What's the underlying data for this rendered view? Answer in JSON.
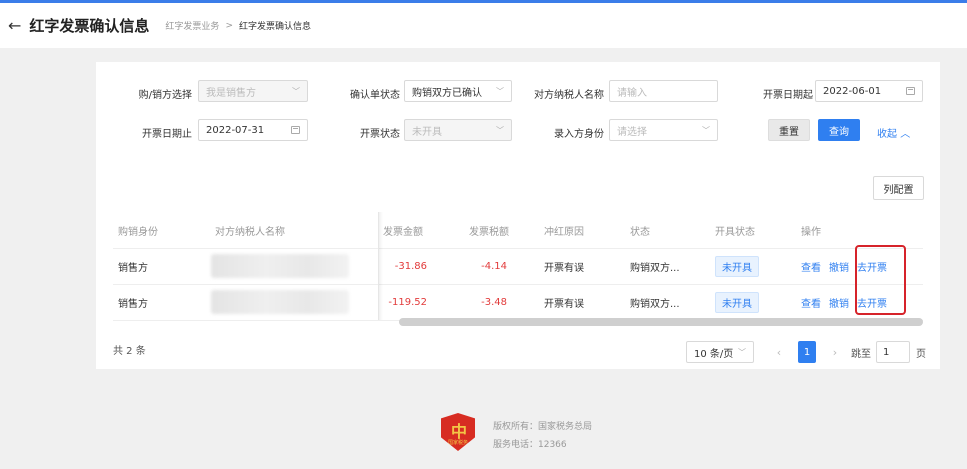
{
  "header": {
    "title": "红字发票确认信息",
    "breadcrumb": [
      "红字发票业务",
      "红字发票确认信息"
    ],
    "breadcrumb_sep": ">"
  },
  "filters": {
    "role_label": "购/销方选择",
    "role_value": "我是销售方",
    "confirm_status_label": "确认单状态",
    "confirm_status_value": "购销双方已确认",
    "counterparty_label": "对方纳税人名称",
    "counterparty_placeholder": "请输入",
    "date_start_label": "开票日期起",
    "date_start_value": "2022-06-01",
    "date_end_label": "开票日期止",
    "date_end_value": "2022-07-31",
    "issue_status_label": "开票状态",
    "issue_status_value": "未开具",
    "entry_identity_label": "录入方身份",
    "entry_identity_placeholder": "请选择"
  },
  "actions": {
    "reset": "重置",
    "query": "查询",
    "collapse": "收起",
    "columns": "列配置"
  },
  "table": {
    "headers": [
      "购销身份",
      "对方纳税人名称",
      "发票金额",
      "发票税额",
      "冲红原因",
      "状态",
      "开具状态",
      "操作"
    ],
    "rows": [
      {
        "role": "销售方",
        "amount": "-31.86",
        "tax": "-4.14",
        "reason": "开票有误",
        "status": "购销双方...",
        "issue_status": "未开具"
      },
      {
        "role": "销售方",
        "amount": "-119.52",
        "tax": "-3.48",
        "reason": "开票有误",
        "status": "购销双方...",
        "issue_status": "未开具"
      }
    ],
    "ops": {
      "view": "查看",
      "revoke": "撤销",
      "issue": "去开票"
    }
  },
  "pagination": {
    "total": "共 2 条",
    "page_size": "10 条/页",
    "current_page": "1",
    "jump_label": "跳至",
    "jump_value": "1",
    "page_unit": "页"
  },
  "footer": {
    "copyright": "版权所有：国家税务总局",
    "phone": "服务电话：12366",
    "logo_text": "国家税务"
  },
  "colors": {
    "accent": "#2f7ff0",
    "negative": "#e23b3b",
    "highlight": "#d6232a"
  }
}
